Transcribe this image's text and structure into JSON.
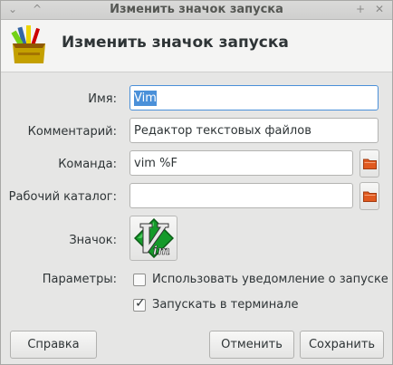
{
  "window": {
    "title": "Изменить значок запуска",
    "btn_left": "⌄",
    "btn_right1": "+",
    "btn_right2": "✕",
    "btn_left2": "^"
  },
  "header": {
    "title": "Изменить значок запуска"
  },
  "form": {
    "name_label": "Имя:",
    "name_value": "Vim",
    "comment_label": "Комментарий:",
    "comment_value": "Редактор текстовых файлов",
    "command_label": "Команда:",
    "command_value": "vim %F",
    "workdir_label": "Рабочий каталог:",
    "workdir_value": "",
    "icon_label": "Значок:",
    "icon_name": "vim-icon",
    "options_label": "Параметры:",
    "startup_notify_label": "Использовать уведомление о запуске",
    "startup_notify_checked": false,
    "run_in_terminal_label": "Запускать в терминале",
    "run_in_terminal_checked": true
  },
  "buttons": {
    "help": "Справка",
    "cancel": "Отменить",
    "save": "Сохранить"
  },
  "colors": {
    "accent": "#4a90d9",
    "folder": "#e0591f",
    "vim_green": "#159a2a"
  }
}
